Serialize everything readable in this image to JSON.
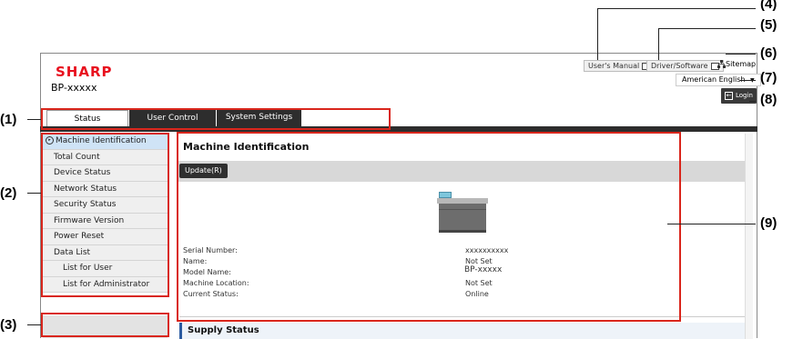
{
  "header": {
    "logo": "SHARP",
    "model": "BP-xxxxx",
    "users_manual": "User's Manual",
    "driver_software": "Driver/Software",
    "sitemap": "Sitemap",
    "language": "American English",
    "login": "Login"
  },
  "tabs": [
    {
      "label": "Status"
    },
    {
      "label": "User Control"
    },
    {
      "label": "System Settings"
    }
  ],
  "sidebar": {
    "items": [
      {
        "label": "Machine Identification"
      },
      {
        "label": "Total Count"
      },
      {
        "label": "Device Status"
      },
      {
        "label": "Network Status"
      },
      {
        "label": "Security Status"
      },
      {
        "label": "Firmware Version"
      },
      {
        "label": "Power Reset"
      },
      {
        "label": "Data List"
      },
      {
        "label": "List for User"
      },
      {
        "label": "List for Administrator"
      }
    ]
  },
  "main": {
    "title": "Machine Identification",
    "update_button": "Update(R)",
    "info": [
      {
        "label": "Serial Number:",
        "value": "xxxxxxxxxx"
      },
      {
        "label": "Name:",
        "value": "Not Set"
      },
      {
        "label": "Model Name:",
        "value": "BP-xxxxx"
      },
      {
        "label": "Machine Location:",
        "value": "Not Set"
      },
      {
        "label": "Current Status:",
        "value": "Online"
      }
    ],
    "supply_status": "Supply Status"
  },
  "callouts": [
    "(1)",
    "(2)",
    "(3)",
    "(4)",
    "(5)",
    "(6)",
    "(7)",
    "(8)",
    "(9)"
  ],
  "colors": {
    "brand": "#e8101e",
    "callout_box": "#d9261c",
    "dark": "#2d2d2d",
    "selected": "#cfe3f6"
  }
}
